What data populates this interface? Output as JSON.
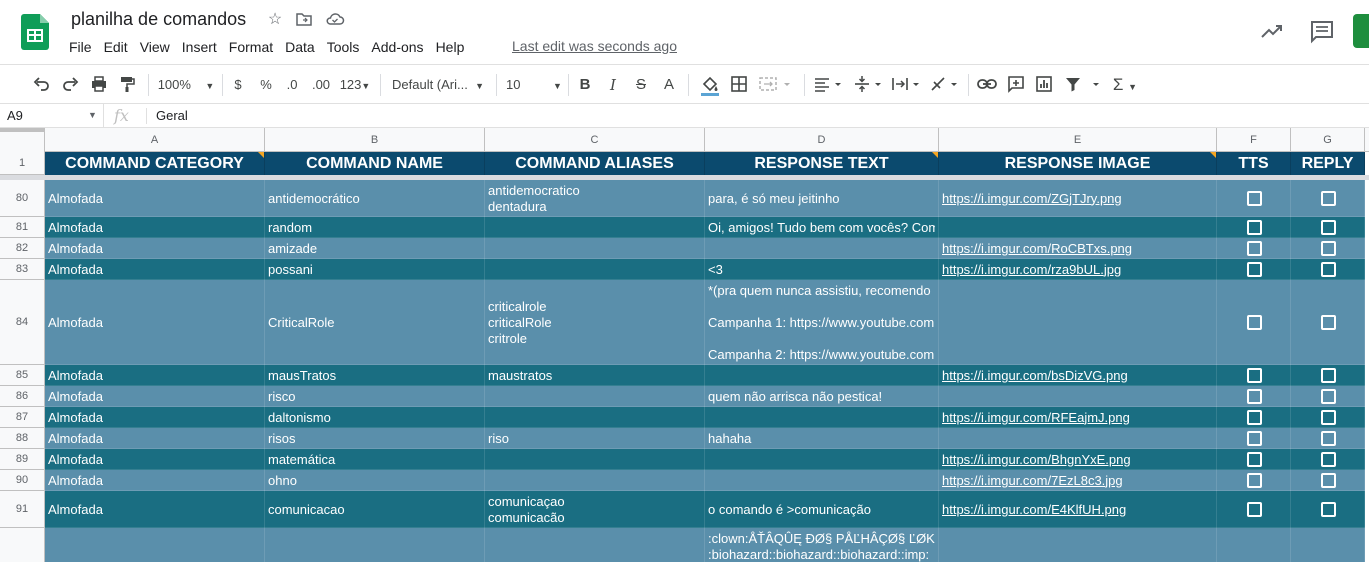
{
  "app": {
    "doc_title": "planilha de comandos",
    "menu": [
      "File",
      "Edit",
      "View",
      "Insert",
      "Format",
      "Data",
      "Tools",
      "Add-ons",
      "Help"
    ],
    "last_edit": "Last edit was seconds ago"
  },
  "toolbar": {
    "zoom": "100%",
    "currency": "$",
    "percent": "%",
    "dec_decrease": ".0",
    "dec_increase": ".00",
    "more_formats": "123",
    "font": "Default (Ari...",
    "font_size": "10",
    "bold": "B",
    "italic": "I",
    "strike": "S",
    "text_color": "A",
    "sum": "Σ"
  },
  "formula_bar": {
    "cell_ref": "A9",
    "fx": "fx",
    "value": "Geral"
  },
  "grid": {
    "column_letters": [
      "A",
      "B",
      "C",
      "D",
      "E",
      "F",
      "G"
    ],
    "header_row_number": "1",
    "headers": [
      "COMMAND CATEGORY",
      "COMMAND NAME",
      "COMMAND ALIASES",
      "RESPONSE TEXT",
      "RESPONSE IMAGE",
      "TTS",
      "REPLY"
    ],
    "rows": [
      {
        "num": "80",
        "category": "Almofada",
        "name": "antidemocrático",
        "aliases": [
          "antidemocratico",
          "dentadura"
        ],
        "text": [
          "para, é só meu jeitinho"
        ],
        "image": "https://i.imgur.com/ZGjTJry.png"
      },
      {
        "num": "81",
        "category": "Almofada",
        "name": "random",
        "aliases": [],
        "text": [
          "Oi, amigos! Tudo bem com vocês? Com"
        ],
        "image": ""
      },
      {
        "num": "82",
        "category": "Almofada",
        "name": "amizade",
        "aliases": [],
        "text": [],
        "image": "https://i.imgur.com/RoCBTxs.png"
      },
      {
        "num": "83",
        "category": "Almofada",
        "name": "possani",
        "aliases": [],
        "text": [
          "<3"
        ],
        "image": "https://i.imgur.com/rza9bUL.jpg"
      },
      {
        "num": "84",
        "category": "Almofada",
        "name": "CriticalRole",
        "aliases": [
          "criticalrole",
          "criticalRole",
          "critrole"
        ],
        "text": [
          "*(pra quem nunca assistiu, recomendo",
          "",
          "Campanha 1: https://www.youtube.com",
          "",
          "Campanha 2: https://www.youtube.com"
        ],
        "image": ""
      },
      {
        "num": "85",
        "category": "Almofada",
        "name": "mausTratos",
        "aliases": [
          "maustratos"
        ],
        "text": [],
        "image": "https://i.imgur.com/bsDizVG.png"
      },
      {
        "num": "86",
        "category": "Almofada",
        "name": "risco",
        "aliases": [],
        "text": [
          "quem não arrisca não pestica!"
        ],
        "image": ""
      },
      {
        "num": "87",
        "category": "Almofada",
        "name": "daltonismo",
        "aliases": [],
        "text": [],
        "image": "https://i.imgur.com/RFEajmJ.png"
      },
      {
        "num": "88",
        "category": "Almofada",
        "name": "risos",
        "aliases": [
          "riso"
        ],
        "text": [
          "hahaha"
        ],
        "image": ""
      },
      {
        "num": "89",
        "category": "Almofada",
        "name": "matemática",
        "aliases": [],
        "text": [],
        "image": "https://i.imgur.com/BhgnYxE.png"
      },
      {
        "num": "90",
        "category": "Almofada",
        "name": "ohno",
        "aliases": [],
        "text": [],
        "image": "https://i.imgur.com/7EzL8c3.jpg"
      },
      {
        "num": "91",
        "category": "Almofada",
        "name": "comunicacao",
        "aliases": [
          "comunicaçao",
          "comunicacão"
        ],
        "text": [
          "o comando é >comunicação"
        ],
        "image": "https://i.imgur.com/E4KlfUH.png"
      },
      {
        "num": "",
        "category": "",
        "name": "",
        "aliases": [],
        "text": [
          ":clown:ÅŤÂQÛĘ ÐØ§ PÅĽHÂÇØ§ ĽØK",
          ":biohazard::biohazard::biohazard::imp:"
        ],
        "image": ""
      }
    ]
  },
  "colors": {
    "header_bg": "#0b4a6e",
    "row_light": "#5a8fab",
    "row_dark": "#1a6e82",
    "sheets_green": "#0f9d58"
  }
}
